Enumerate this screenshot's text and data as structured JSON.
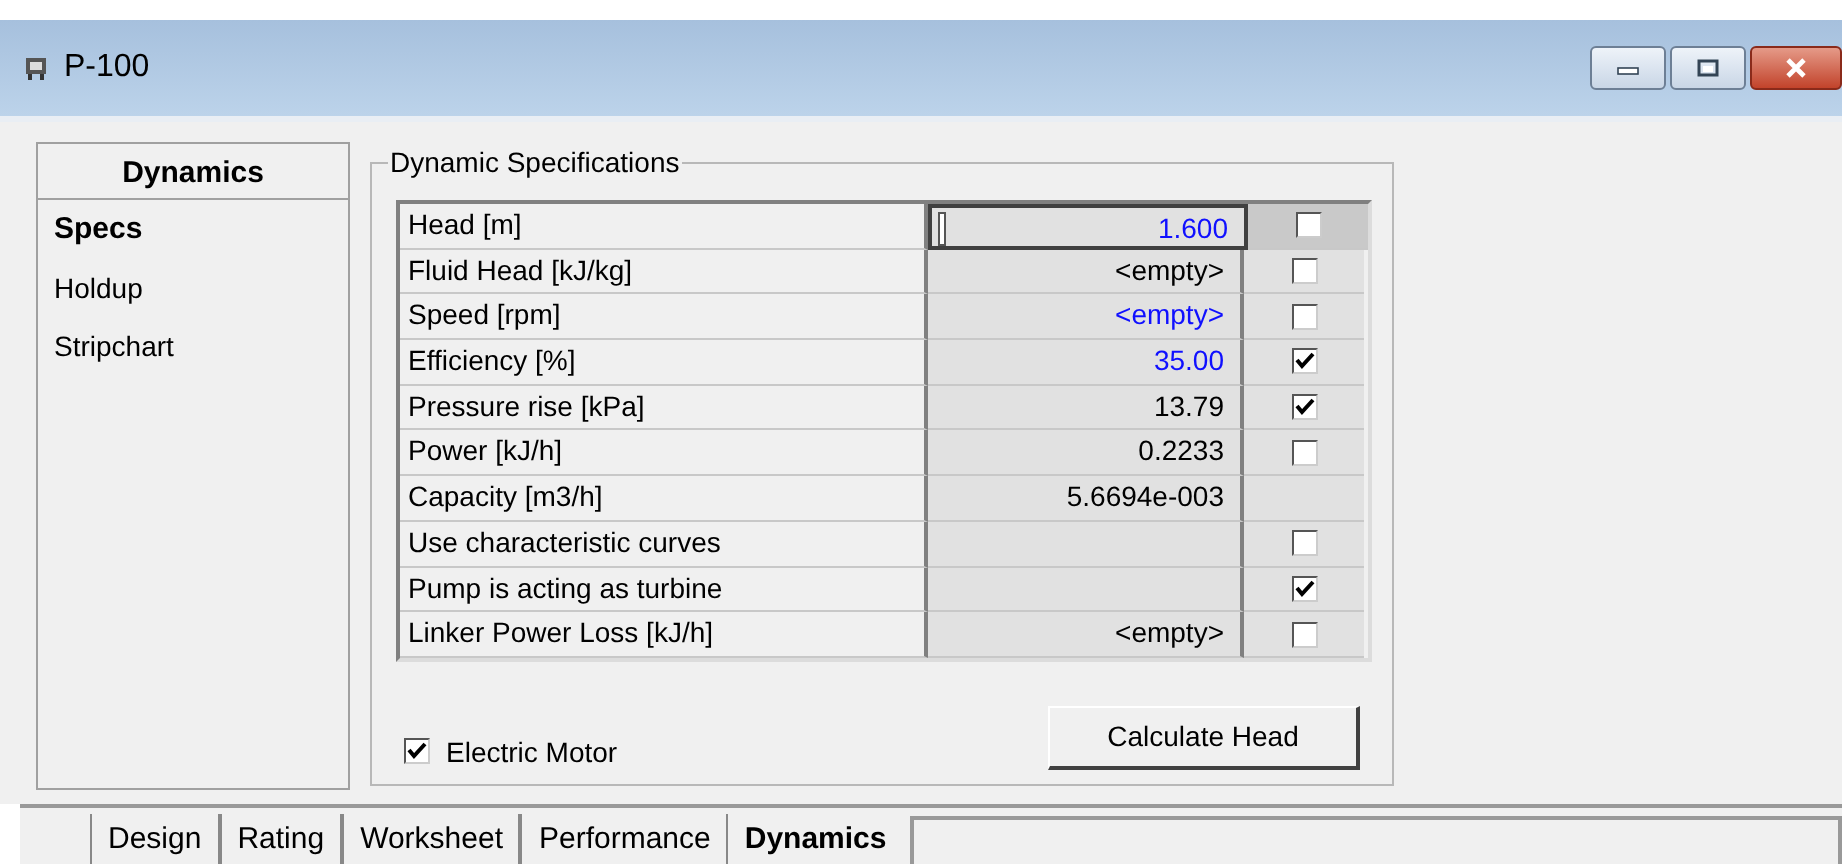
{
  "window": {
    "title": "P-100"
  },
  "sidebar": {
    "heading": "Dynamics",
    "items": [
      {
        "label": "Specs",
        "selected": true
      },
      {
        "label": "Holdup",
        "selected": false
      },
      {
        "label": "Stripchart",
        "selected": false
      }
    ]
  },
  "group": {
    "title": "Dynamic Specifications",
    "rows": [
      {
        "label": "Head [m]",
        "value": "1.600",
        "specified": true,
        "focused": true,
        "kind": "check",
        "checked": false
      },
      {
        "label": "Fluid Head [kJ/kg]",
        "value": "<empty>",
        "specified": false,
        "focused": false,
        "kind": "check",
        "checked": false
      },
      {
        "label": "Speed [rpm]",
        "value": "<empty>",
        "specified": true,
        "focused": false,
        "kind": "check",
        "checked": false
      },
      {
        "label": "Efficiency [%]",
        "value": "35.00",
        "specified": true,
        "focused": false,
        "kind": "check",
        "checked": true
      },
      {
        "label": "Pressure rise [kPa]",
        "value": "13.79",
        "specified": false,
        "focused": false,
        "kind": "check",
        "checked": true
      },
      {
        "label": "Power [kJ/h]",
        "value": "0.2233",
        "specified": false,
        "focused": false,
        "kind": "check",
        "checked": false
      },
      {
        "label": "Capacity [m3/h]",
        "value": "5.6694e-003",
        "specified": false,
        "focused": false,
        "kind": "plain"
      },
      {
        "label": "Use characteristic curves",
        "focused": false,
        "kind": "check",
        "checked": false
      },
      {
        "label": "Pump is acting as turbine",
        "focused": false,
        "kind": "check",
        "checked": true
      },
      {
        "label": "Linker Power Loss [kJ/h]",
        "value": "<empty>",
        "specified": false,
        "focused": false,
        "kind": "check",
        "checked": false
      }
    ],
    "electric_motor": {
      "label": "Electric Motor",
      "checked": true
    },
    "button": "Calculate Head"
  },
  "tabs": [
    {
      "label": "Design",
      "selected": false
    },
    {
      "label": "Rating",
      "selected": false
    },
    {
      "label": "Worksheet",
      "selected": false
    },
    {
      "label": "Performance",
      "selected": false
    },
    {
      "label": "Dynamics",
      "selected": true
    }
  ]
}
